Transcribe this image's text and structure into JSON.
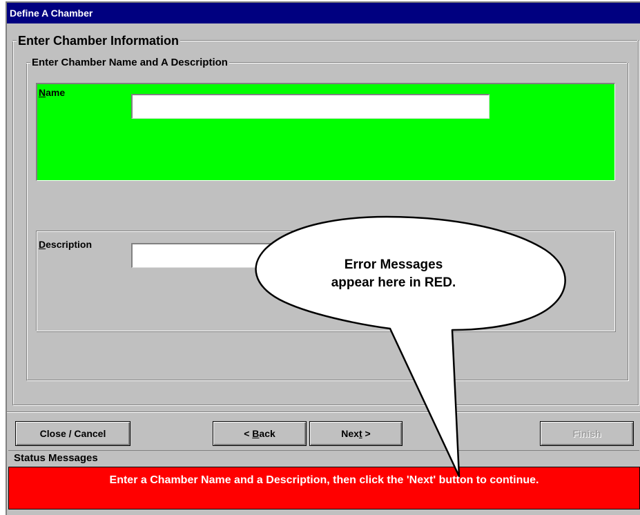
{
  "window": {
    "title": "Define A Chamber"
  },
  "outer_group": {
    "legend": "Enter Chamber Information"
  },
  "inner_group": {
    "legend": "Enter Chamber Name and A Description"
  },
  "name_field": {
    "label_accel": "N",
    "label_rest": "ame",
    "value": ""
  },
  "description_field": {
    "label_accel": "D",
    "label_rest": "escription",
    "value": ""
  },
  "buttons": {
    "close": "Close / Cancel",
    "back_prefix": "< ",
    "back_accel": "B",
    "back_rest": "ack",
    "next_prefix": "Nex",
    "next_accel": "t",
    "next_rest": " >",
    "finish": "Finish"
  },
  "status": {
    "label": "Status Messages",
    "message": "Enter a Chamber Name and a Description, then click the 'Next' button to continue."
  },
  "callout": {
    "line1": "Error Messages",
    "line2": "appear here in RED."
  },
  "colors": {
    "title_bar": "#000080",
    "name_panel": "#00ff00",
    "status_error": "#ff0000",
    "dialog_face": "#c0c0c0"
  }
}
